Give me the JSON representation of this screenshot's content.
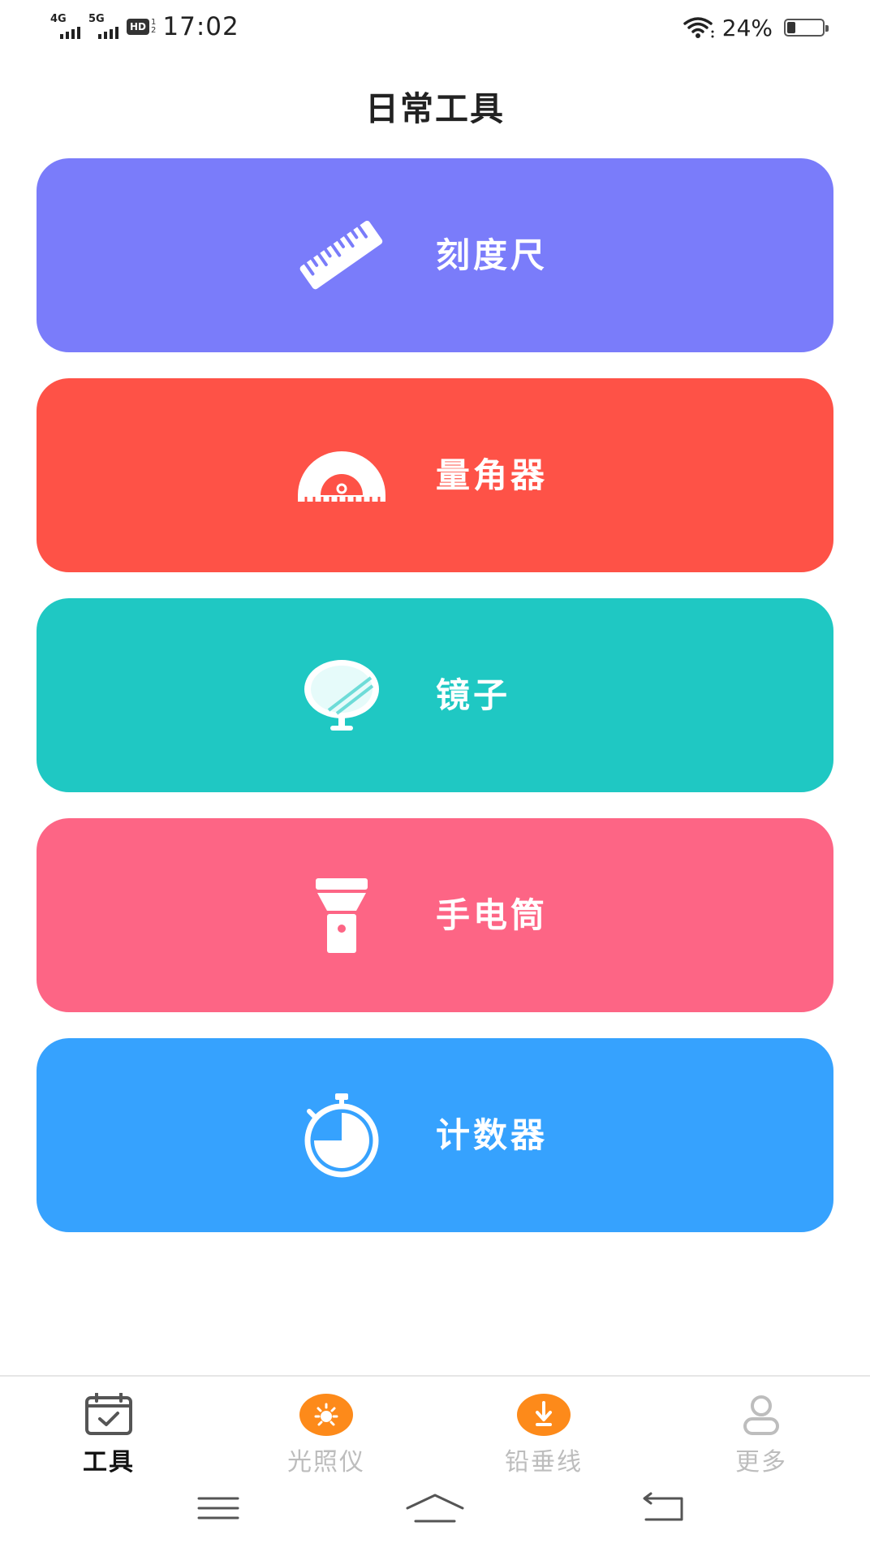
{
  "status_bar": {
    "network1": "4G",
    "network2": "5G",
    "hd": "HD",
    "hd_sub": "1",
    "hd_sub2": "2",
    "time": "17:02",
    "battery": "24%"
  },
  "page_title": "日常工具",
  "tools": [
    {
      "label": "刻度尺",
      "icon": "ruler-icon",
      "color": "#7a7cfa"
    },
    {
      "label": "量角器",
      "icon": "protractor-icon",
      "color": "#fe5247"
    },
    {
      "label": "镜子",
      "icon": "mirror-icon",
      "color": "#1fc8c3"
    },
    {
      "label": "手电筒",
      "icon": "flashlight-icon",
      "color": "#fd6585"
    },
    {
      "label": "计数器",
      "icon": "stopwatch-icon",
      "color": "#36a2fe"
    }
  ],
  "bottom_nav": {
    "items": [
      {
        "label": "工具",
        "icon": "calendar-check-icon",
        "active": true
      },
      {
        "label": "光照仪",
        "icon": "sun-icon",
        "active": false
      },
      {
        "label": "铅垂线",
        "icon": "plumb-arrow-icon",
        "active": false
      },
      {
        "label": "更多",
        "icon": "user-icon",
        "active": false
      }
    ]
  },
  "colors": {
    "nav_accent": "#fd8a1a",
    "nav_inactive": "#bdbdbd"
  }
}
